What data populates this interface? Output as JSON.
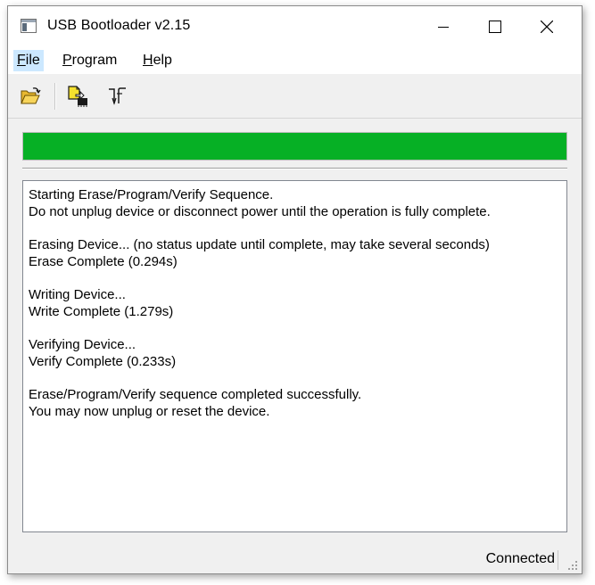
{
  "window": {
    "title": "USB Bootloader v2.15",
    "icon": "app-window-icon"
  },
  "titlebar_buttons": [
    "minimize-icon",
    "maximize-icon",
    "close-icon"
  ],
  "menu": {
    "file": {
      "mnemonic": "F",
      "rest": "ile"
    },
    "program": {
      "mnemonic": "P",
      "rest": "rogram"
    },
    "help": {
      "mnemonic": "H",
      "rest": "elp"
    }
  },
  "toolbar": {
    "icons": [
      "open-folder-icon",
      "program-device-icon",
      "reset-device-icon"
    ]
  },
  "progress": {
    "value": 1.0,
    "color": "#06b025"
  },
  "log": {
    "lines": [
      "Starting Erase/Program/Verify Sequence.",
      "Do not unplug device or disconnect power until the operation is fully complete.",
      "",
      "Erasing Device... (no status update until complete, may take several seconds)",
      "Erase Complete (0.294s)",
      "",
      "Writing Device...",
      "Write Complete (1.279s)",
      "",
      "Verifying Device...",
      "Verify Complete (0.233s)",
      "",
      "Erase/Program/Verify sequence completed successfully.",
      "You may now unplug or reset the device."
    ]
  },
  "status": {
    "text": "Connected"
  }
}
